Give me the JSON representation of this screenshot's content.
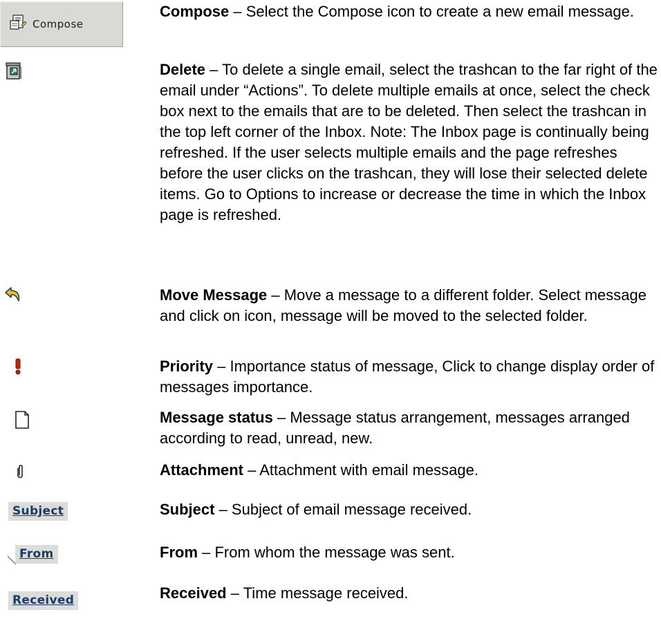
{
  "compose": {
    "button_label": "Compose",
    "title": "Compose",
    "text": " – Select the Compose icon to create a new email message."
  },
  "delete": {
    "title": "Delete",
    "text": " – To delete a single email, select the trashcan to the far right of the email under “Actions”. To delete multiple emails at once, select the check box next to the emails that are to be deleted. Then select the trashcan in the top left corner of the Inbox. Note: The Inbox page is continually being refreshed. If the user selects multiple emails and the page refreshes before the user clicks on the trashcan, they will lose their selected delete items. Go to Options to increase or decrease the time in which the Inbox page is refreshed."
  },
  "move": {
    "title": "Move Message",
    "text": " – Move a message to a different folder. Select message and click on icon, message will be moved to the selected folder."
  },
  "priority": {
    "title": "Priority",
    "text": " – Importance status of message, Click to change display order of messages importance."
  },
  "status": {
    "title": "Message status",
    "text": " –  Message status arrangement, messages arranged according to read, unread, new."
  },
  "attachment": {
    "title": "Attachment",
    "text": " – Attachment with email message."
  },
  "subject": {
    "link_label": "Subject",
    "title": "Subject",
    "text": " – Subject of email message received."
  },
  "from": {
    "link_label": "From",
    "title": "From",
    "text": " – From whom the message was sent."
  },
  "received": {
    "link_label": "Received",
    "title": "Received",
    "text": " – Time message received."
  },
  "icons": {
    "compose": "compose-icon",
    "delete": "trashcan-icon",
    "move": "move-arrow-icon",
    "priority": "exclamation-icon",
    "status": "page-icon",
    "attachment": "paperclip-icon"
  },
  "colors": {
    "button_bg": "#d9d9d5",
    "link_color": "#1c3b6b",
    "priority_red": "#cc2200"
  }
}
